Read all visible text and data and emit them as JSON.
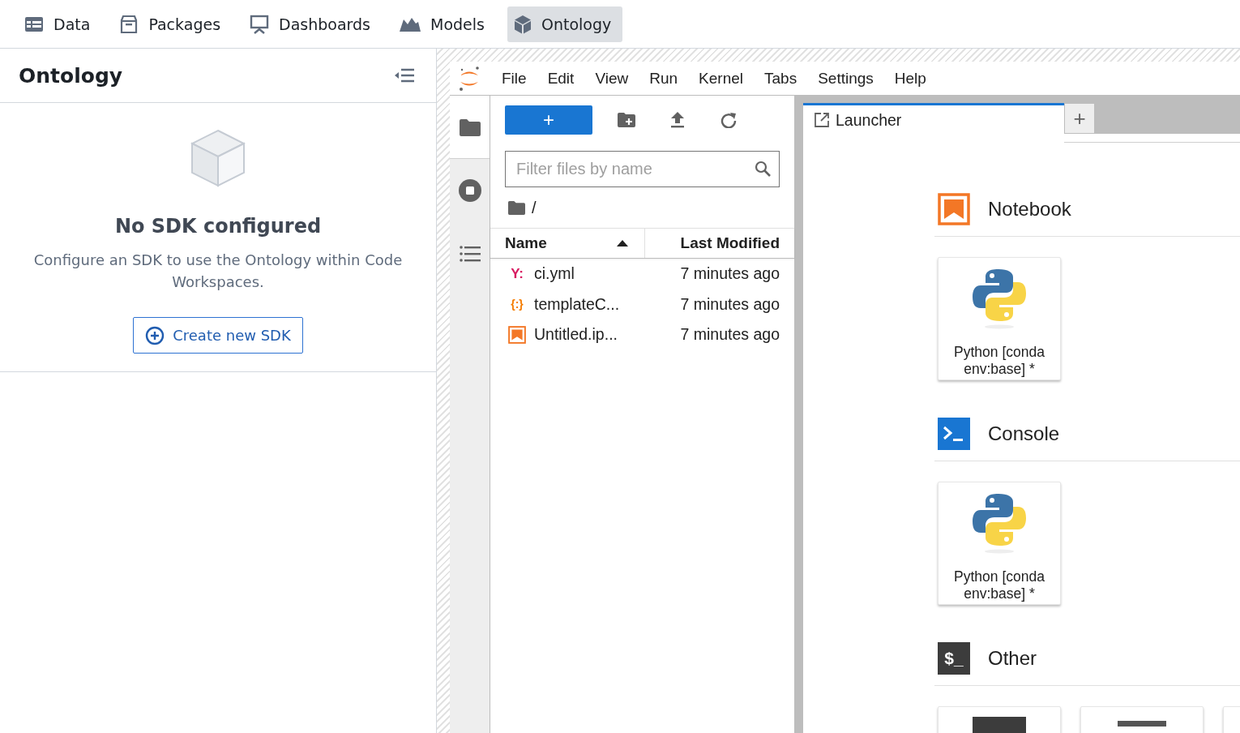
{
  "top_nav": [
    {
      "label": "Data",
      "kind": "table",
      "selected": false
    },
    {
      "label": "Packages",
      "kind": "package",
      "selected": false
    },
    {
      "label": "Dashboards",
      "kind": "presentation",
      "selected": false
    },
    {
      "label": "Models",
      "kind": "mountain",
      "selected": false
    },
    {
      "label": "Ontology",
      "kind": "cube",
      "selected": true
    }
  ],
  "ontology_panel": {
    "title": "Ontology",
    "empty_state": {
      "title": "No SDK configured",
      "description": "Configure an SDK to use the Ontology within Code Workspaces.",
      "button": "Create new SDK"
    }
  },
  "jupyter": {
    "menu": [
      "File",
      "Edit",
      "View",
      "Run",
      "Kernel",
      "Tabs",
      "Settings",
      "Help"
    ],
    "side_tabs": [
      {
        "kind": "folder",
        "selected": true
      },
      {
        "kind": "stop",
        "selected": false
      },
      {
        "kind": "list",
        "selected": false
      }
    ],
    "file_browser": {
      "new_button": "+",
      "filter": {
        "placeholder": "Filter files by name"
      },
      "path": "/",
      "columns": [
        {
          "label": "Name",
          "sorted": true
        },
        {
          "label": "Last Modified",
          "sorted": false
        }
      ],
      "files": [
        {
          "name": "ci.yml",
          "kind": "yaml",
          "glyph": "Y:",
          "modified": "7 minutes ago"
        },
        {
          "name": "templateC...",
          "kind": "json",
          "glyph": "{:}",
          "modified": "7 minutes ago"
        },
        {
          "name": "Untitled.ip...",
          "kind": "notebook",
          "modified": "7 minutes ago"
        }
      ]
    },
    "tabs": [
      {
        "label": "Launcher",
        "selected": true
      }
    ],
    "add_tab": "+",
    "launcher": [
      {
        "title": "Notebook",
        "kind": "notebook",
        "cards": [
          {
            "label": "Python [conda env:base] *",
            "kind": "python"
          }
        ]
      },
      {
        "title": "Console",
        "kind": "console",
        "cards": [
          {
            "label": "Python [conda env:base] *",
            "kind": "python"
          }
        ]
      },
      {
        "title": "Other",
        "kind": "other",
        "glyph": "$_",
        "cards": [
          {
            "kind": "block"
          },
          {
            "kind": "bar"
          },
          {
            "kind": "blank"
          }
        ]
      }
    ]
  }
}
